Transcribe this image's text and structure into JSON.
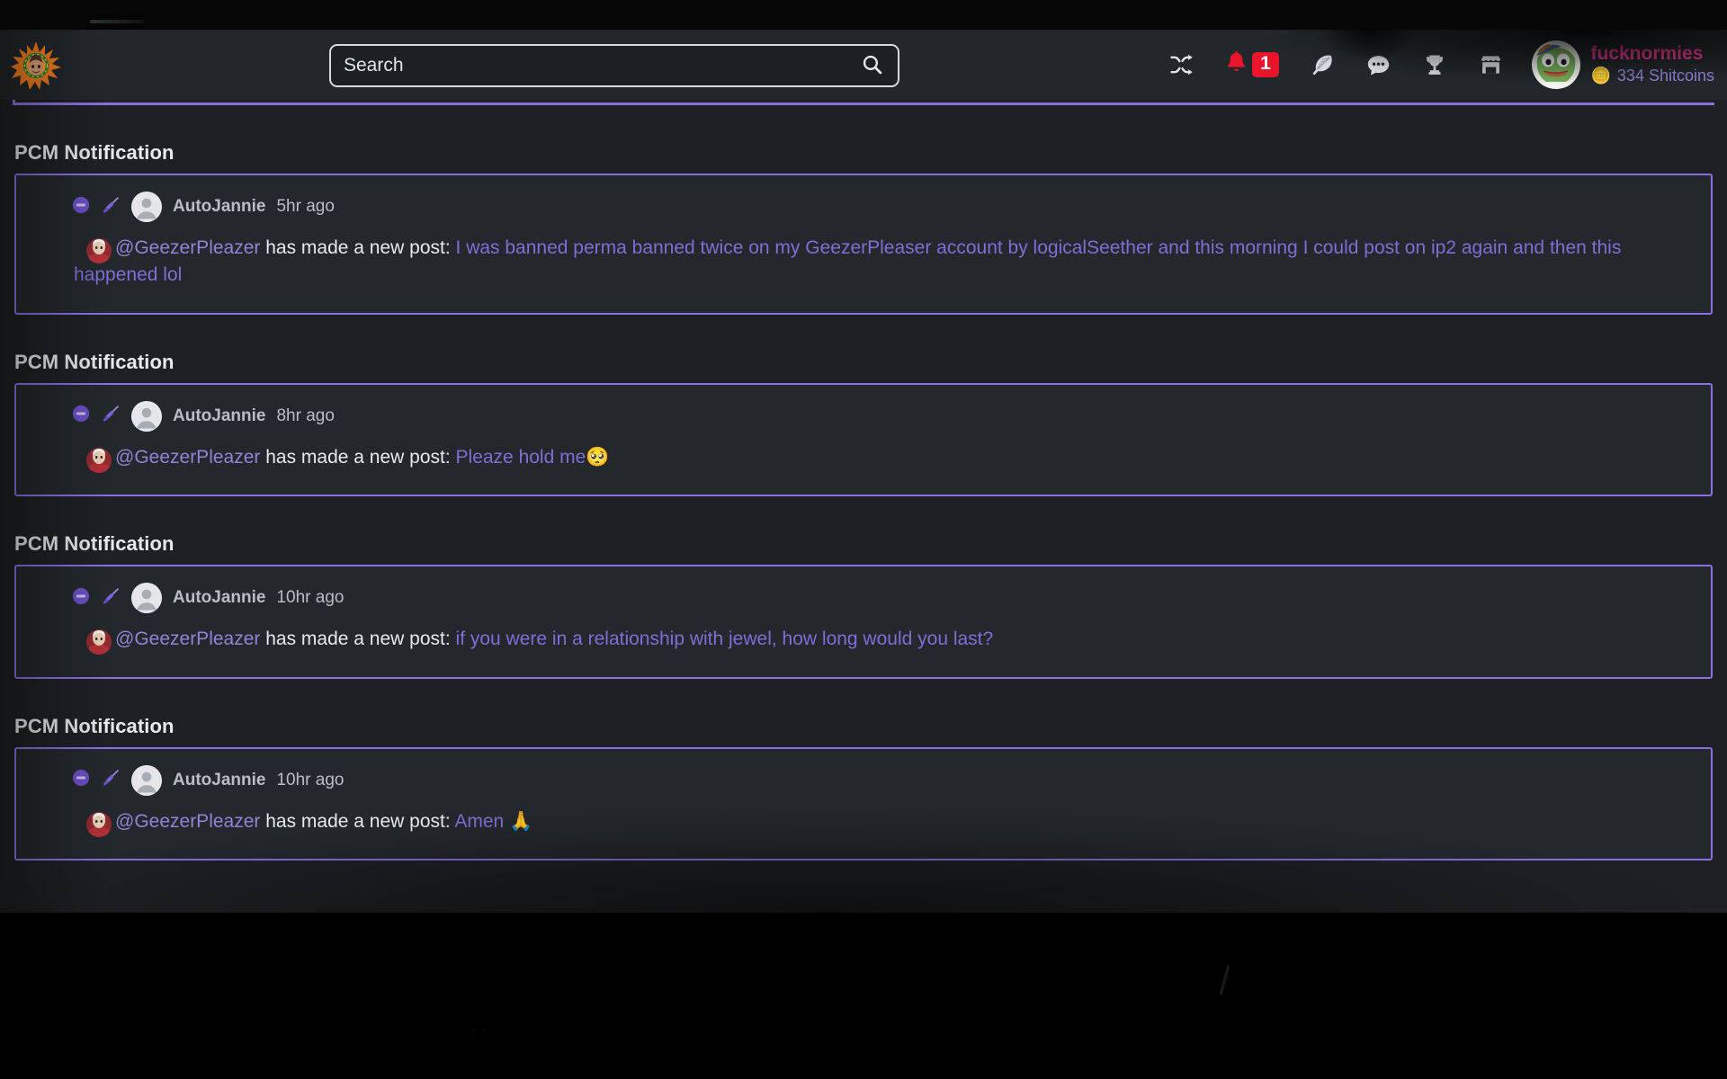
{
  "colors": {
    "page_bg": "#1d2125",
    "header_bg": "#22272b",
    "accent_purple": "#8c6fe0",
    "link_purple": "#7c6fd6",
    "mention_purple": "#8c86d8",
    "username_pink": "#e8398f",
    "badge_red": "#e8152b",
    "text_primary": "#e7e9eb",
    "text_muted": "#b9bdc4"
  },
  "header": {
    "logo_name": "pcm-logo",
    "search": {
      "placeholder": "Search",
      "value": "",
      "submit_icon": "search-icon"
    },
    "icons": [
      {
        "name": "shuffle-icon",
        "label": "Shuffle"
      },
      {
        "name": "bell-icon",
        "label": "Notifications",
        "badge": "1"
      },
      {
        "name": "feather-icon",
        "label": "Create Post"
      },
      {
        "name": "chat-bubble-icon",
        "label": "Chat"
      },
      {
        "name": "trophy-icon",
        "label": "Leaderboard"
      },
      {
        "name": "shop-icon",
        "label": "Shop"
      }
    ],
    "user": {
      "avatar_name": "pepe-avatar",
      "username": "fucknormies",
      "coin_emoji": "🪙",
      "coins_label": "334 Shitcoins"
    }
  },
  "notifications": [
    {
      "section_title": "PCM Notification",
      "mod_action_icon": "minus-circle-icon",
      "broom_icon": "broom-icon",
      "author": "AutoJannie",
      "time": "5hr ago",
      "mention": "@GeezerPleazer",
      "action_text": " has made a new post: ",
      "post_title": "I was banned perma banned twice on my GeezerPleaser account by logicalSeether and this morning I could post on ip2 again and then this happened lol"
    },
    {
      "section_title": "PCM Notification",
      "mod_action_icon": "minus-circle-icon",
      "broom_icon": "broom-icon",
      "author": "AutoJannie",
      "time": "8hr ago",
      "mention": "@GeezerPleazer",
      "action_text": " has made a new post: ",
      "post_title": "Pleaze hold me🥺"
    },
    {
      "section_title": "PCM Notification",
      "mod_action_icon": "minus-circle-icon",
      "broom_icon": "broom-icon",
      "author": "AutoJannie",
      "time": "10hr ago",
      "mention": "@GeezerPleazer",
      "action_text": " has made a new post: ",
      "post_title": "if you were in a relationship with jewel, how long would you last?"
    },
    {
      "section_title": "PCM Notification",
      "mod_action_icon": "minus-circle-icon",
      "broom_icon": "broom-icon",
      "author": "AutoJannie",
      "time": "10hr ago",
      "mention": "@GeezerPleazer",
      "action_text": " has made a new post: ",
      "post_title": "Amen 🙏"
    }
  ]
}
